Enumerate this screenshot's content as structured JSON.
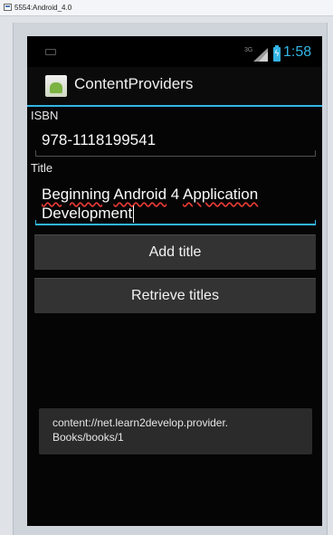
{
  "window": {
    "title": "5554:Android_4.0"
  },
  "status_bar": {
    "network": "3G",
    "time": "1:58",
    "accent_color": "#33b5e5"
  },
  "action_bar": {
    "title": "ContentProviders",
    "icon": "android-app-icon"
  },
  "form": {
    "isbn_label": "ISBN",
    "isbn_value": "978-1118199541",
    "title_label": "Title",
    "title_words": [
      "Beginning",
      "Android",
      "4",
      "Application",
      "Development"
    ]
  },
  "buttons": {
    "add_title": "Add title",
    "retrieve_titles": "Retrieve titles"
  },
  "toast": {
    "message": "content://net.learn2develop.provider.\nBooks/books/1"
  }
}
